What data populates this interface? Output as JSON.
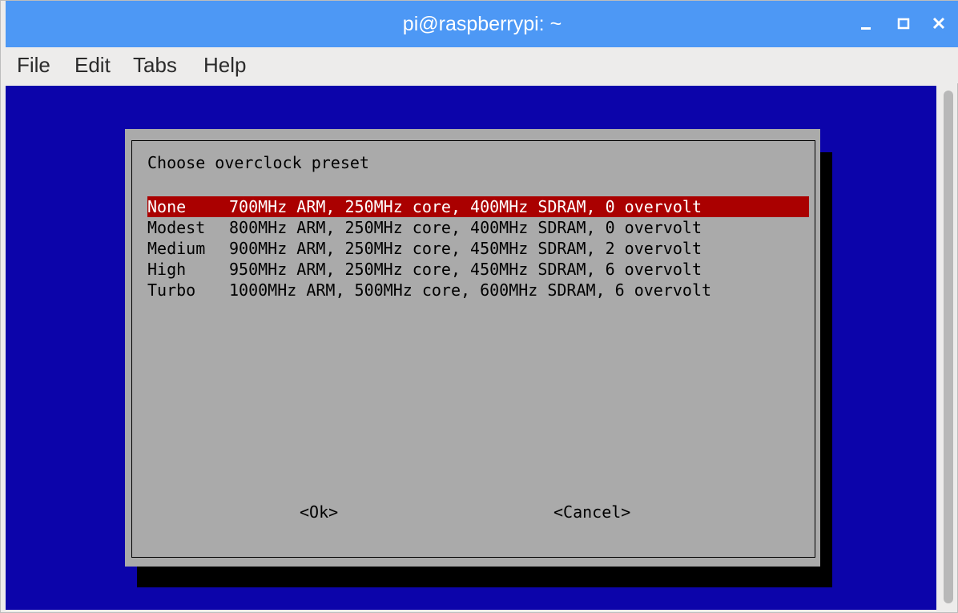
{
  "window": {
    "title": "pi@raspberrypi: ~"
  },
  "menubar": {
    "items": [
      {
        "label": "File"
      },
      {
        "label": "Edit"
      },
      {
        "label": "Tabs"
      },
      {
        "label": "Help"
      }
    ]
  },
  "dialog": {
    "title": "Choose overclock preset",
    "items": [
      {
        "tag": "None",
        "description": "700MHz ARM, 250MHz core, 400MHz SDRAM, 0 overvolt",
        "selected": true
      },
      {
        "tag": "Modest",
        "description": "800MHz ARM, 250MHz core, 400MHz SDRAM, 0 overvolt",
        "selected": false
      },
      {
        "tag": "Medium",
        "description": "900MHz ARM, 250MHz core, 450MHz SDRAM, 2 overvolt",
        "selected": false
      },
      {
        "tag": "High",
        "description": "950MHz ARM, 250MHz core, 450MHz SDRAM, 6 overvolt",
        "selected": false
      },
      {
        "tag": "Turbo",
        "description": "1000MHz ARM, 500MHz core, 600MHz SDRAM, 6 overvolt",
        "selected": false
      }
    ],
    "ok_label": "<Ok>",
    "cancel_label": "<Cancel>"
  },
  "colors": {
    "titlebar": "#4d98f5",
    "terminal_background": "#0c04aa",
    "dialog_background": "#aaaaaa",
    "selection": "#aa0000"
  },
  "icons": {
    "minimize": "minimize-icon",
    "maximize": "maximize-icon",
    "close": "close-icon"
  }
}
